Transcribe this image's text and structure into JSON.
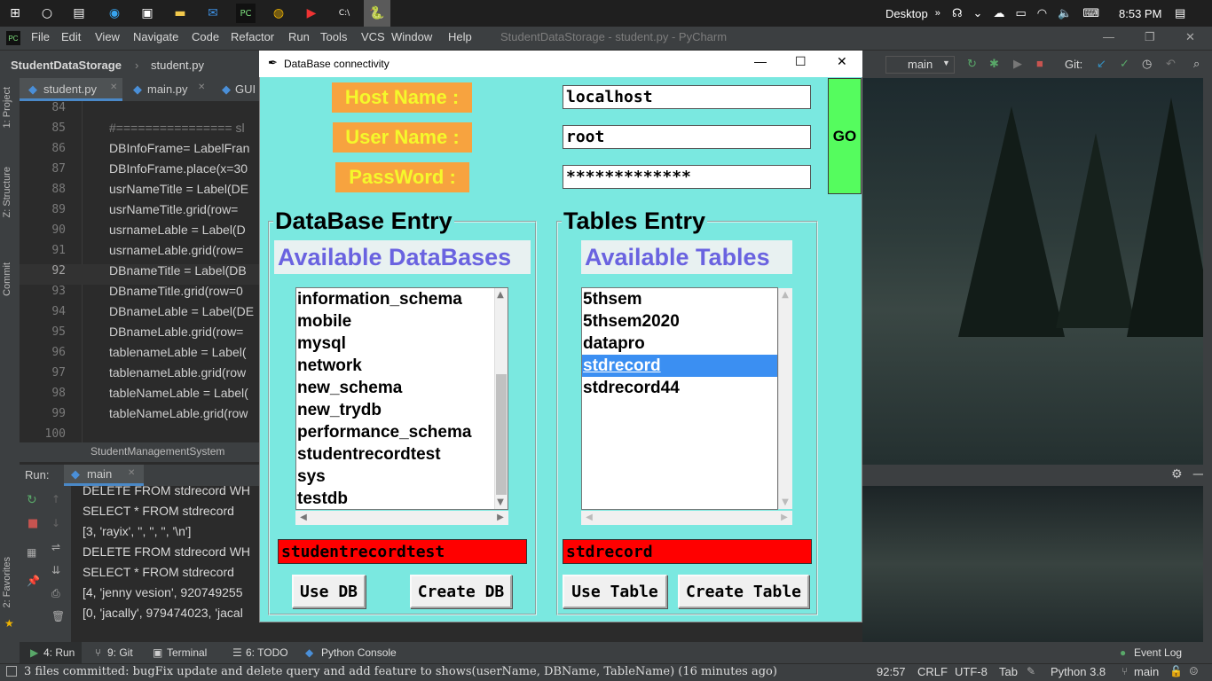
{
  "taskbar": {
    "desktop_label": "Desktop",
    "chevrons": "»",
    "time": "8:53 PM"
  },
  "pycharm": {
    "menu": [
      "File",
      "Edit",
      "View",
      "Navigate",
      "Code",
      "Refactor",
      "Run",
      "Tools",
      "VCS",
      "Window",
      "Help"
    ],
    "window_title": "StudentDataStorage - student.py - PyCharm",
    "breadcrumb": {
      "project": "StudentDataStorage",
      "file": "student.py"
    },
    "branch": "main",
    "git_label": "Git:",
    "tabs": [
      "student.py",
      "main.py",
      "GUI"
    ],
    "side_tabs": {
      "project": "1: Project",
      "structure": "Z: Structure",
      "commit": "Commit",
      "favorites": "2: Favorites"
    },
    "line_numbers": [
      "84",
      "85",
      "86",
      "87",
      "88",
      "89",
      "90",
      "91",
      "92",
      "93",
      "94",
      "95",
      "96",
      "97",
      "98",
      "99",
      "100"
    ],
    "code_lines": [
      "",
      "#================ sl",
      "DBInfoFrame= LabelFran",
      "DBInfoFrame.place(x=30",
      "usrNameTitle = Label(DE",
      "usrNameTitle.grid(row=",
      "usrnameLable = Label(D",
      "usrnameLable.grid(row=",
      "DBnameTitle = Label(DB",
      "DBnameTitle.grid(row=0",
      "DBnameLable = Label(DE",
      "DBnameLable.grid(row=",
      "tablenameLable = Label(",
      "tablenameLable.grid(row",
      "tableNameLable = Label(",
      "tableNameLable.grid(row",
      ""
    ],
    "editor_breadcrumb": "StudentManagementSystem",
    "run_label": "Run:",
    "run_config": "main",
    "run_output": [
      "DELETE FROM stdrecord WH",
      "SELECT * FROM stdrecord",
      "[3, 'rayix', '', '', '', '\\n']",
      "DELETE FROM stdrecord WH",
      "SELECT * FROM stdrecord",
      "[4, 'jenny vesion', 920749255",
      "[0, 'jacally', 979474023, 'jacal"
    ],
    "bottom_tools": [
      "4: Run",
      "9: Git",
      "Terminal",
      "6: TODO",
      "Python Console",
      "Event Log"
    ],
    "status_message": "3 files committed: bugFix update and delete query and add feature to shows(userName, DBName, TableName) (16 minutes ago)",
    "status_right": {
      "position": "92:57",
      "line_sep": "CRLF",
      "encoding": "UTF-8",
      "indent": "Tab",
      "interpreter": "Python 3.8",
      "branch": "main"
    }
  },
  "dialog": {
    "title": "DataBase connectivity",
    "host_label": "Host Name :",
    "user_label": "User Name :",
    "password_label": "PassWord :",
    "host_value": "localhost",
    "user_value": "root",
    "password_value": "*************",
    "go_label": "GO",
    "db_frame_title": "DataBase Entry",
    "db_available_title": "Available DataBases",
    "databases": [
      "information_schema",
      "mobile",
      "mysql",
      "network",
      "new_schema",
      "new_trydb",
      "performance_schema",
      "studentrecordtest",
      "sys",
      "testdb"
    ],
    "selected_db_value": "studentrecordtest",
    "use_db_label": "Use DB",
    "create_db_label": "Create DB",
    "tables_frame_title": "Tables Entry",
    "tables_available_title": "Available Tables",
    "tables": [
      "5thsem",
      "5thsem2020",
      "datapro",
      "stdrecord",
      "stdrecord44"
    ],
    "selected_table_index": 3,
    "selected_table_value": "stdrecord",
    "use_table_label": "Use Table",
    "create_table_label": "Create Table"
  },
  "colors": {
    "dialog_bg": "#7ae8e0",
    "label_bg": "#f7a33f",
    "label_fg": "#f5f82b",
    "go_bg": "#55fc5e",
    "available_fg": "#6a63e0",
    "selection_bg": "#3b8ff2",
    "red_entry": "#ff0000"
  }
}
